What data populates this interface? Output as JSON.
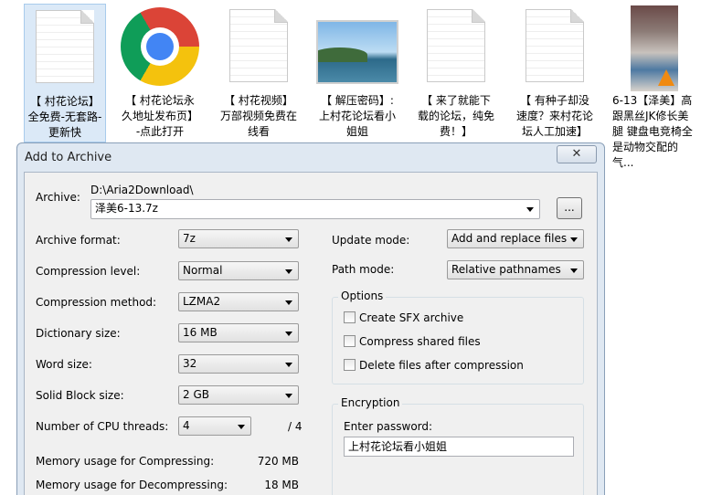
{
  "desktop": {
    "icons": [
      {
        "label": "【 村花论坛】全免费-无套路-更新快"
      },
      {
        "label": "【 村花论坛永久地址发布页】-点此打开"
      },
      {
        "label": "【 村花视频】万部视频免费在线看"
      },
      {
        "label": "【 解压密码】:上村花论坛看小姐姐"
      },
      {
        "label": "【 来了就能下载的论坛，纯免费！】"
      },
      {
        "label": "【 有种子却没速度？来村花论坛人工加速】"
      },
      {
        "label": "6-13【泽美】高跟黑丝JK修长美腿 键盘电竞椅全是动物交配的气..."
      }
    ]
  },
  "dialog": {
    "title": "Add to Archive",
    "close_symbol": "✕",
    "archive_label": "Archive:",
    "archive_path": "D:\\Aria2Download\\",
    "archive_name": "泽美6-13.7z",
    "browse_label": "...",
    "format_label": "Archive format:",
    "format_value": "7z",
    "level_label": "Compression level:",
    "level_value": "Normal",
    "method_label": "Compression method:",
    "method_value": "LZMA2",
    "dict_label": "Dictionary size:",
    "dict_value": "16 MB",
    "word_label": "Word size:",
    "word_value": "32",
    "solid_label": "Solid Block size:",
    "solid_value": "2 GB",
    "threads_label": "Number of CPU threads:",
    "threads_value": "4",
    "threads_total": "/ 4",
    "mem_comp_label": "Memory usage for Compressing:",
    "mem_comp_value": "720 MB",
    "mem_decomp_label": "Memory usage for Decompressing:",
    "mem_decomp_value": "18 MB",
    "update_label": "Update mode:",
    "update_value": "Add and replace files",
    "path_label": "Path mode:",
    "path_value": "Relative pathnames",
    "options_title": "Options",
    "opt_sfx": "Create SFX archive",
    "opt_shared": "Compress shared files",
    "opt_delete": "Delete files after compression",
    "encryption_title": "Encryption",
    "password_label": "Enter password:",
    "password_value": "上村花论坛看小姐姐"
  }
}
